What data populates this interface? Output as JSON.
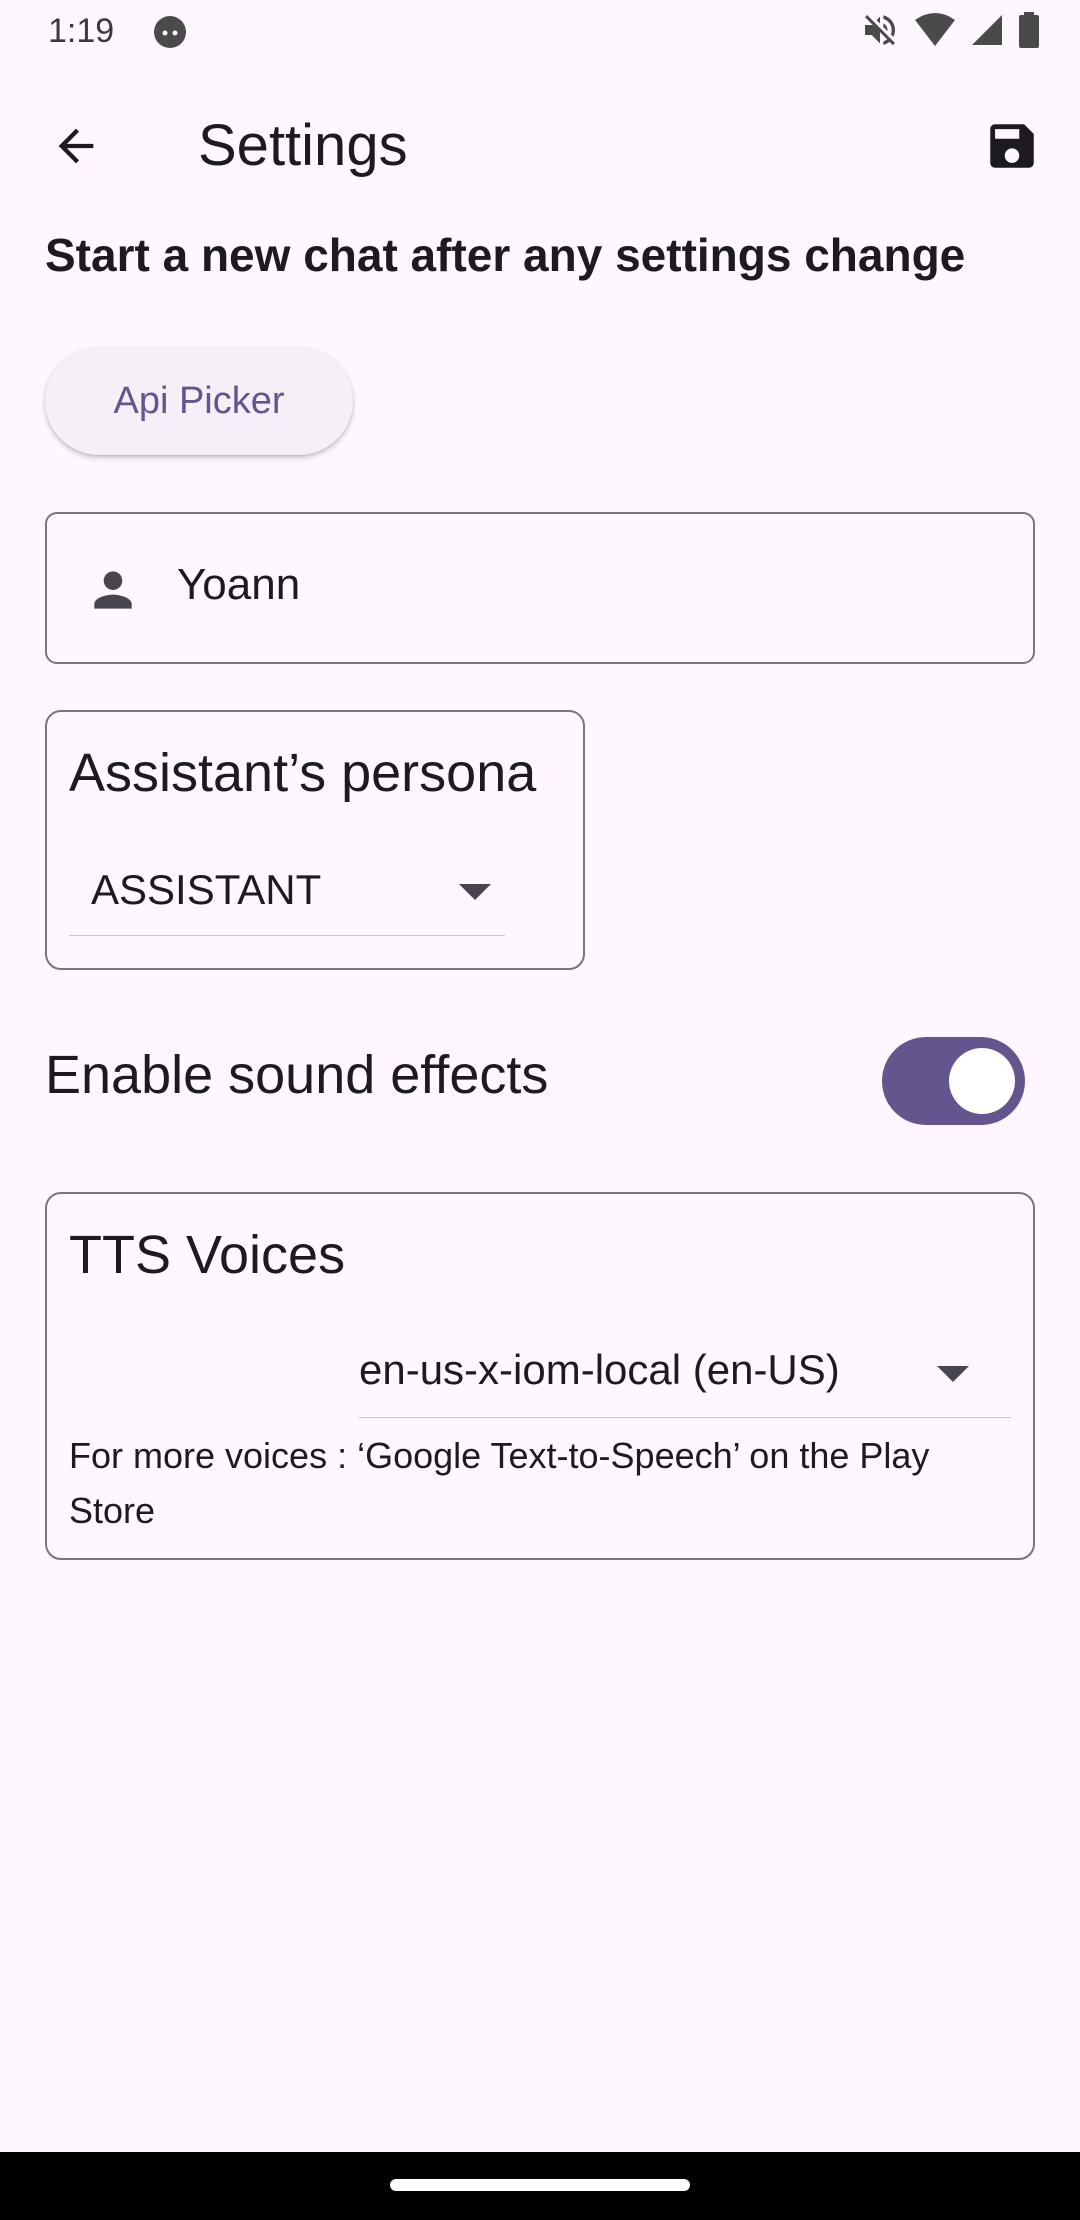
{
  "status_bar": {
    "time": "1:19",
    "icons": [
      "cat-notification-icon",
      "mute-icon",
      "wifi-icon",
      "signal-icon",
      "battery-icon"
    ]
  },
  "app_bar": {
    "title": "Settings",
    "back_icon": "arrow-back-icon",
    "save_icon": "save-icon"
  },
  "notice": "Start a new chat after any settings change",
  "api_picker": {
    "label": "Api Picker"
  },
  "name_field": {
    "icon": "person-icon",
    "value": "Yoann"
  },
  "persona": {
    "title": "Assistant’s persona",
    "selected": "ASSISTANT"
  },
  "sound_effects": {
    "label": "Enable sound effects",
    "enabled": true
  },
  "tts": {
    "title": "TTS Voices",
    "selected": "en-us-x-iom-local (en-US)",
    "hint": "For more voices : ‘Google Text-to-Speech’ on the Play Store"
  },
  "colors": {
    "background": "#fef7ff",
    "accent": "#65558f",
    "outline": "#79747e",
    "text": "#1d1b20"
  }
}
